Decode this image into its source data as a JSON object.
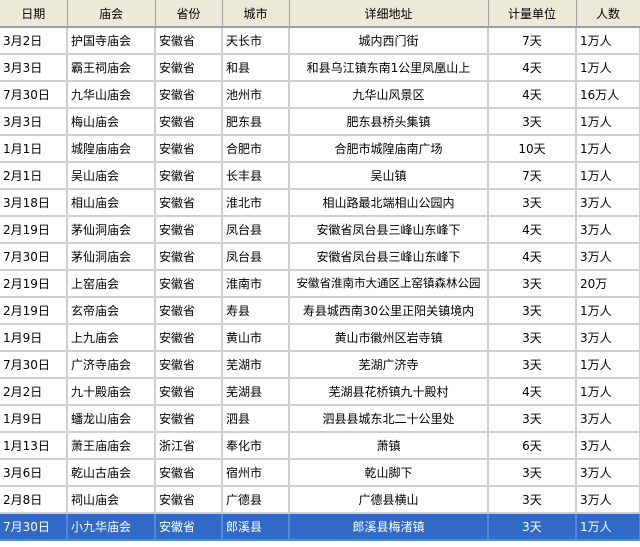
{
  "columns": [
    "日期",
    "庙会",
    "省份",
    "城市",
    "详细地址",
    "计量单位",
    "人数"
  ],
  "selected_row_index": 19,
  "selection_color": "#316ac5",
  "header_bg": "#ece9d8",
  "rows": [
    {
      "date": "3月2日",
      "fair": "护国寺庙会",
      "province": "安徽省",
      "city": "天长市",
      "address": "城内西门街",
      "duration": "7天",
      "people": "1万人"
    },
    {
      "date": "3月3日",
      "fair": "霸王祠庙会",
      "province": "安徽省",
      "city": "和县",
      "address": "和县乌江镇东南1公里凤凰山上",
      "duration": "4天",
      "people": "1万人"
    },
    {
      "date": "7月30日",
      "fair": "九华山庙会",
      "province": "安徽省",
      "city": "池州市",
      "address": "九华山风景区",
      "duration": "4天",
      "people": "16万人"
    },
    {
      "date": "3月3日",
      "fair": "梅山庙会",
      "province": "安徽省",
      "city": "肥东县",
      "address": "肥东县桥头集镇",
      "duration": "3天",
      "people": "1万人"
    },
    {
      "date": "1月1日",
      "fair": "城隍庙庙会",
      "province": "安徽省",
      "city": "合肥市",
      "address": "合肥市城隍庙南广场",
      "duration": "10天",
      "people": "1万人"
    },
    {
      "date": "2月1日",
      "fair": "吴山庙会",
      "province": "安徽省",
      "city": "长丰县",
      "address": "吴山镇",
      "duration": "7天",
      "people": "1万人"
    },
    {
      "date": "3月18日",
      "fair": "相山庙会",
      "province": "安徽省",
      "city": "淮北市",
      "address": "相山路最北端相山公园内",
      "duration": "3天",
      "people": "3万人"
    },
    {
      "date": "2月19日",
      "fair": "茅仙洞庙会",
      "province": "安徽省",
      "city": "凤台县",
      "address": "安徽省凤台县三峰山东峰下",
      "duration": "4天",
      "people": "3万人"
    },
    {
      "date": "7月30日",
      "fair": "茅仙洞庙会",
      "province": "安徽省",
      "city": "凤台县",
      "address": "安徽省凤台县三峰山东峰下",
      "duration": "4天",
      "people": "3万人"
    },
    {
      "date": "2月19日",
      "fair": "上窑庙会",
      "province": "安徽省",
      "city": "淮南市",
      "address": "安徽省淮南市大通区上窑镇森林公园",
      "duration": "3天",
      "people": "20万"
    },
    {
      "date": "2月19日",
      "fair": "玄帝庙会",
      "province": "安徽省",
      "city": "寿县",
      "address": "寿县城西南30公里正阳关镇境内",
      "duration": "3天",
      "people": "1万人"
    },
    {
      "date": "1月9日",
      "fair": "上九庙会",
      "province": "安徽省",
      "city": "黄山市",
      "address": "黄山市徽州区岩寺镇",
      "duration": "3天",
      "people": "3万人"
    },
    {
      "date": "7月30日",
      "fair": "广济寺庙会",
      "province": "安徽省",
      "city": "芜湖市",
      "address": "芜湖广济寺",
      "duration": "3天",
      "people": "1万人"
    },
    {
      "date": "2月2日",
      "fair": "九十殿庙会",
      "province": "安徽省",
      "city": "芜湖县",
      "address": "芜湖县花桥镇九十殿村",
      "duration": "4天",
      "people": "1万人"
    },
    {
      "date": "1月9日",
      "fair": "蟠龙山庙会",
      "province": "安徽省",
      "city": "泗县",
      "address": "泗县县城东北二十公里处",
      "duration": "3天",
      "people": "3万人"
    },
    {
      "date": "1月13日",
      "fair": "萧王庙庙会",
      "province": "浙江省",
      "city": "奉化市",
      "address": "萧镇",
      "duration": "6天",
      "people": "3万人"
    },
    {
      "date": "3月6日",
      "fair": "乾山古庙会",
      "province": "安徽省",
      "city": "宿州市",
      "address": "乾山脚下",
      "duration": "3天",
      "people": "3万人"
    },
    {
      "date": "2月8日",
      "fair": "祠山庙会",
      "province": "安徽省",
      "city": "广德县",
      "address": "广德县横山",
      "duration": "3天",
      "people": "3万人"
    },
    {
      "date": "7月30日",
      "fair": "小九华庙会",
      "province": "安徽省",
      "city": "郎溪县",
      "address": "郎溪县梅渚镇",
      "duration": "3天",
      "people": "1万人"
    }
  ]
}
